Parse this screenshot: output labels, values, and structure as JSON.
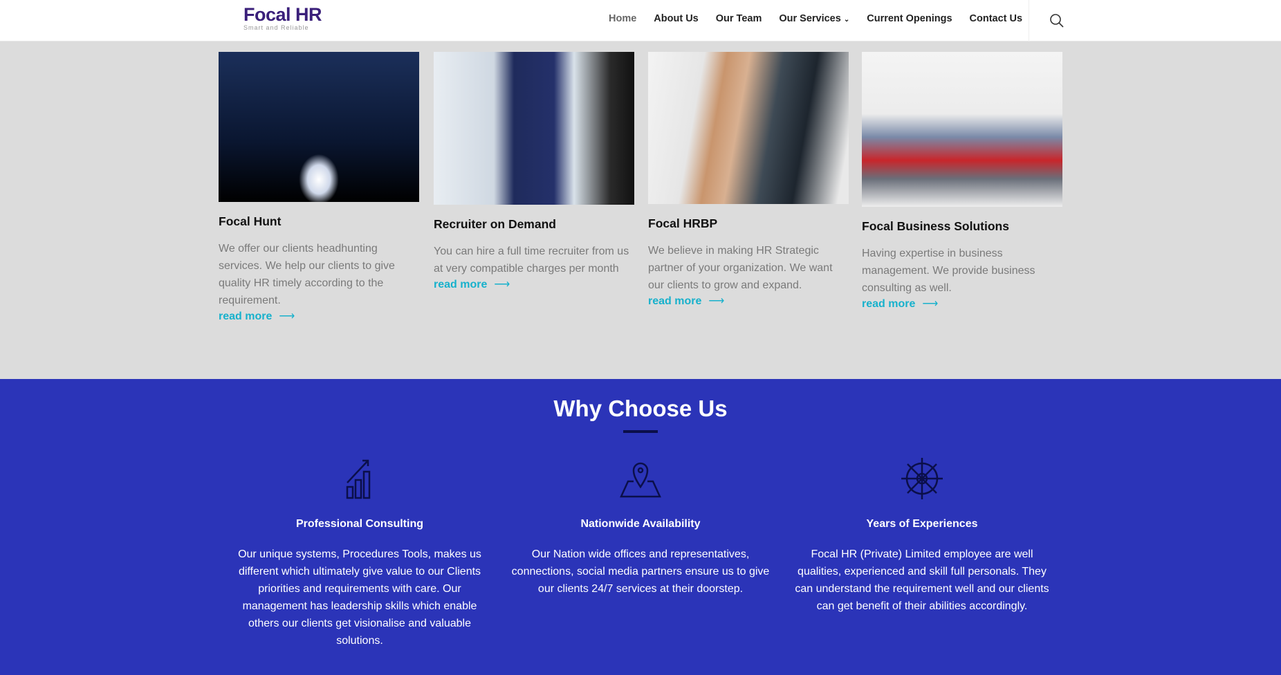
{
  "header": {
    "logo_text": "Focal HR",
    "logo_tagline": "Smart and Reliable",
    "nav": [
      "Home",
      "About Us",
      "Our Team",
      "Our Services",
      "Current Openings",
      "Contact Us"
    ],
    "search_icon": "search-icon"
  },
  "services": [
    {
      "title": "Focal Hunt",
      "desc": "We offer our clients headhunting services. We help our clients to give quality HR timely according to the requirement.",
      "link": "read more"
    },
    {
      "title": "Recruiter on Demand",
      "desc": "You can hire a full time recruiter from us at very compatible charges per month",
      "link": "read more"
    },
    {
      "title": "Focal HRBP",
      "desc": "We believe in making HR Strategic partner of your organization. We want our clients to grow and expand.",
      "link": "read more"
    },
    {
      "title": "Focal Business Solutions",
      "desc": "Having expertise in business management. We provide business consulting as well.",
      "link": "read more"
    }
  ],
  "why": {
    "title": "Why Choose Us",
    "items": [
      {
        "icon": "bar-chart-growth-icon",
        "title": "Professional Consulting",
        "text": "Our unique systems, Procedures Tools, makes us different which ultimately give value to our Clients priorities and requirements with care. Our management has leadership skills which enable others our clients get visionalise and valuable solutions."
      },
      {
        "icon": "map-pin-icon",
        "title": "Nationwide Availability",
        "text": "Our Nation wide offices and representatives, connections, social media partners ensure us to give our clients 24/7 services at their doorstep."
      },
      {
        "icon": "ship-wheel-icon",
        "title": "Years of Experiences",
        "text": "Focal HR (Private) Limited employee are well qualities, experienced and skill full personals. They can understand the requirement well and our clients can get benefit of their abilities accordingly."
      }
    ]
  },
  "colors": {
    "accent": "#17b1cc",
    "section_blue": "#2b34b8",
    "gray_bg": "#dcdcdc"
  }
}
